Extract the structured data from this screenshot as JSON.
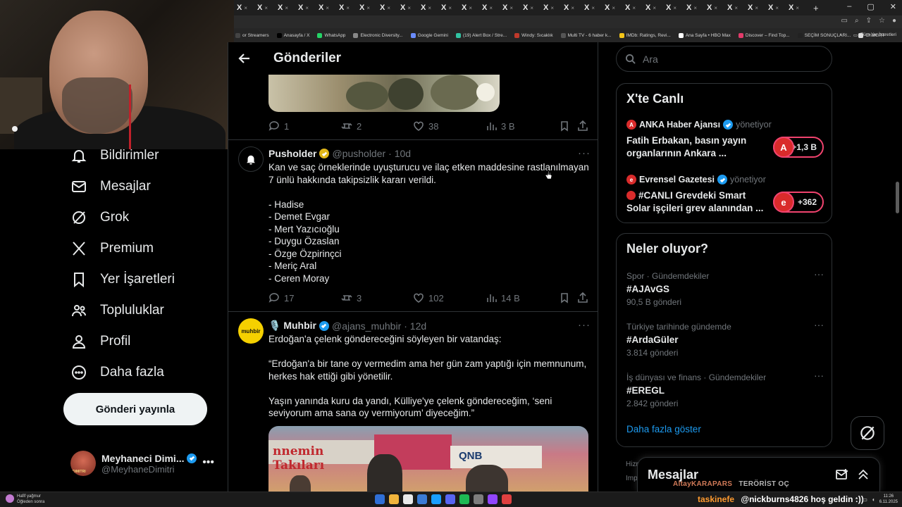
{
  "browser": {
    "tab_glyph": "X",
    "tab_close": "×",
    "tab_count": 28,
    "new_tab": "+",
    "window_controls": [
      "–",
      "▢",
      "✕"
    ],
    "bookmarks": [
      {
        "label": "or Streamers",
        "color": "#444"
      },
      {
        "label": "Anasayfa / X",
        "color": "#000"
      },
      {
        "label": "WhatsApp",
        "color": "#25d366"
      },
      {
        "label": "Electronic Diversity...",
        "color": "#888"
      },
      {
        "label": "Google Gemini",
        "color": "#6a8cff"
      },
      {
        "label": "(19) Alert Box / Stre...",
        "color": "#31c3a2"
      },
      {
        "label": "Windy: Sıcaklık",
        "color": "#c0392b"
      },
      {
        "label": "Multi TV - 6 haber k...",
        "color": "#555"
      },
      {
        "label": "IMDb: Ratings, Revi...",
        "color": "#f5c518"
      },
      {
        "label": "Ana Sayfa • HBO Max",
        "color": "#fff"
      },
      {
        "label": "Discover – Find Top...",
        "color": "#e23b6a"
      },
      {
        "label": "SEÇİM SONUÇLARI...",
        "color": "#222"
      },
      {
        "label": "ChatGPT",
        "color": "#ddd"
      }
    ],
    "bookmarks_more": "»",
    "all_bookmarks": "Tüm Yer İşaretleri"
  },
  "nav": {
    "items": [
      {
        "key": "notifications",
        "label": "Bildirimler"
      },
      {
        "key": "messages",
        "label": "Mesajlar"
      },
      {
        "key": "grok",
        "label": "Grok"
      },
      {
        "key": "premium",
        "label": "Premium"
      },
      {
        "key": "bookmarks",
        "label": "Yer İşaretleri"
      },
      {
        "key": "communities",
        "label": "Topluluklar"
      },
      {
        "key": "profile",
        "label": "Profil"
      },
      {
        "key": "more",
        "label": "Daha fazla"
      }
    ],
    "post_button": "Gönderi yayınla",
    "account": {
      "name": "Meyhaneci Dimi...",
      "handle": "@MeyhaneDimitri",
      "more": "•••"
    }
  },
  "main": {
    "title": "Gönderiler",
    "posts": [
      {
        "stats": {
          "replies": "1",
          "reposts": "2",
          "likes": "38",
          "views": "3 B"
        }
      },
      {
        "name": "Pusholder",
        "handle": "@pusholder",
        "time": "· 10d",
        "lines": [
          "Kan ve saç örneklerinde uyuşturucu ve ilaç etken maddesine rastlanılmayan",
          "7 ünlü hakkında takipsizlik kararı verildi.",
          "",
          "- Hadise",
          "- Demet Evgar",
          "- Mert Yazıcıoğlu",
          "- Duygu Özaslan",
          "- Özge Özpirinçci",
          "- Meriç Aral",
          "- Ceren Moray"
        ],
        "stats": {
          "replies": "17",
          "reposts": "3",
          "likes": "102",
          "views": "14 B"
        }
      },
      {
        "name": "🎙️ Muhbir",
        "avatar_text": "muhbir",
        "handle": "@ajans_muhbir",
        "time": "· 12d",
        "lines": [
          "Erdoğan'a çelenk göndereceğini söyleyen bir vatandaş:",
          "",
          "“Erdoğan'a bir tane oy vermedim ama her gün zam yaptığı için memnunum,",
          "herkes hak ettiği gibi yönetilir.",
          "",
          "Yaşın yanında kuru da yandı, Külliye'ye çelenk göndereceğim, ‘seni",
          "seviyorum ama sana oy vermiyorum’ diyeceğim.”"
        ],
        "media_signs": [
          "nnemin Takıları",
          "QNB"
        ]
      }
    ],
    "more_glyph": "···"
  },
  "sidebar": {
    "search_placeholder": "Ara",
    "live": {
      "title": "X'te Canlı",
      "items": [
        {
          "source": "ANKA Haber Ajansı",
          "status": "yönetiyor",
          "text": "Fatih Erbakan, basın yayın organlarının Ankara ...",
          "count": "+1,3 B",
          "avatar": "A"
        },
        {
          "source": "Evrensel Gazetesi",
          "status": "yönetiyor",
          "text": "#CANLI Grevdeki Smart Solar işçileri grev alanından ...",
          "count": "+362",
          "avatar": "e"
        }
      ]
    },
    "trends": {
      "title": "Neler oluyor?",
      "items": [
        {
          "context": "Spor · Gündemdekiler",
          "topic": "#AJAvGS",
          "count": "90,5 B gönderi"
        },
        {
          "context": "Türkiye tarihinde gündemde",
          "topic": "#ArdaGüler",
          "count": "3.814 gönderi"
        },
        {
          "context": "İş dünyası ve finans · Gündemdekiler",
          "topic": "#EREGL",
          "count": "2.842 gönderi"
        }
      ],
      "show_more": "Daha fazla göster"
    },
    "behind_text": [
      "Hizr",
      "Imp"
    ],
    "messages_drawer": "Mesajlar"
  },
  "stream": {
    "overlay_name": "AltayKARAPARS",
    "overlay_text": "TERÖRİST OÇ",
    "chat_user": "taskinefe",
    "chat_message": "@nickburns4826 hoş geldin :))"
  },
  "taskbar": {
    "weather_line1": "Hafif yağmur",
    "weather_line2": "Öğleden sonra",
    "time": "11:26",
    "date": "6.11.2025",
    "apps": [
      "#2f6fd6",
      "#f0b43c",
      "#e9e9e9",
      "#3a7bd5",
      "#1a9fff",
      "#5865f2",
      "#1db954",
      "#7d7d7d",
      "#9146ff",
      "#e04040"
    ]
  }
}
